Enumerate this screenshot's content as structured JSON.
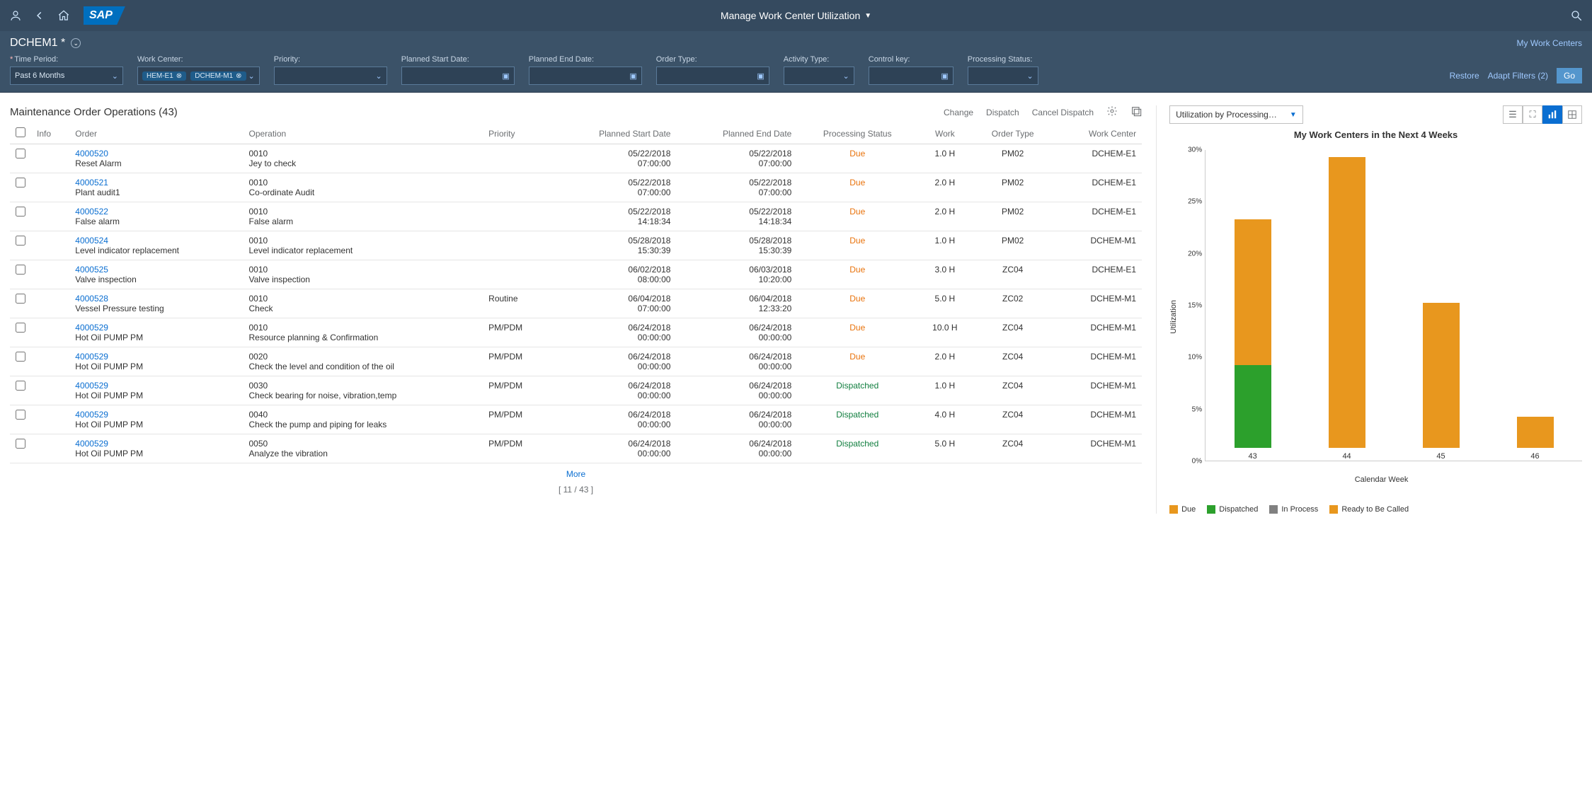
{
  "shell": {
    "title": "Manage Work Center Utilization"
  },
  "subheader": {
    "variant": "DCHEM1 *",
    "link": "My Work Centers"
  },
  "filters": {
    "time_period_label": "Time Period:",
    "time_period_value": "Past 6 Months",
    "work_center_label": "Work Center:",
    "wc_token1": "HEM-E1",
    "wc_token2": "DCHEM-M1",
    "priority_label": "Priority:",
    "planned_start_label": "Planned Start Date:",
    "planned_end_label": "Planned End Date:",
    "order_type_label": "Order Type:",
    "activity_type_label": "Activity Type:",
    "control_key_label": "Control key:",
    "processing_status_label": "Processing Status:",
    "restore": "Restore",
    "adapt": "Adapt Filters (2)",
    "go": "Go"
  },
  "table": {
    "title": "Maintenance Order Operations (43)",
    "action_change": "Change",
    "action_dispatch": "Dispatch",
    "action_cancel": "Cancel Dispatch",
    "cols": {
      "info": "Info",
      "order": "Order",
      "operation": "Operation",
      "priority": "Priority",
      "pstart": "Planned Start Date",
      "pend": "Planned End Date",
      "pstatus": "Processing Status",
      "work": "Work",
      "otype": "Order Type",
      "wc": "Work Center"
    },
    "rows": [
      {
        "order": "4000520",
        "odesc": "Reset Alarm",
        "opnum": "0010",
        "opdesc": "Jey to check",
        "priority": "",
        "pstart_d": "05/22/2018",
        "pstart_t": "07:00:00",
        "pend_d": "05/22/2018",
        "pend_t": "07:00:00",
        "status": "Due",
        "scls": "status-due",
        "work": "1.0 H",
        "otype": "PM02",
        "wc": "DCHEM-E1"
      },
      {
        "order": "4000521",
        "odesc": "Plant audit1",
        "opnum": "0010",
        "opdesc": "Co-ordinate Audit",
        "priority": "",
        "pstart_d": "05/22/2018",
        "pstart_t": "07:00:00",
        "pend_d": "05/22/2018",
        "pend_t": "07:00:00",
        "status": "Due",
        "scls": "status-due",
        "work": "2.0 H",
        "otype": "PM02",
        "wc": "DCHEM-E1"
      },
      {
        "order": "4000522",
        "odesc": "False alarm",
        "opnum": "0010",
        "opdesc": "False alarm",
        "priority": "",
        "pstart_d": "05/22/2018",
        "pstart_t": "14:18:34",
        "pend_d": "05/22/2018",
        "pend_t": "14:18:34",
        "status": "Due",
        "scls": "status-due",
        "work": "2.0 H",
        "otype": "PM02",
        "wc": "DCHEM-E1"
      },
      {
        "order": "4000524",
        "odesc": "Level indicator replacement",
        "opnum": "0010",
        "opdesc": "Level indicator replacement",
        "priority": "",
        "pstart_d": "05/28/2018",
        "pstart_t": "15:30:39",
        "pend_d": "05/28/2018",
        "pend_t": "15:30:39",
        "status": "Due",
        "scls": "status-due",
        "work": "1.0 H",
        "otype": "PM02",
        "wc": "DCHEM-M1"
      },
      {
        "order": "4000525",
        "odesc": "Valve inspection",
        "opnum": "0010",
        "opdesc": "Valve inspection",
        "priority": "",
        "pstart_d": "06/02/2018",
        "pstart_t": "08:00:00",
        "pend_d": "06/03/2018",
        "pend_t": "10:20:00",
        "status": "Due",
        "scls": "status-due",
        "work": "3.0 H",
        "otype": "ZC04",
        "wc": "DCHEM-E1"
      },
      {
        "order": "4000528",
        "odesc": "Vessel Pressure testing",
        "opnum": "0010",
        "opdesc": "Check",
        "priority": "Routine",
        "pstart_d": "06/04/2018",
        "pstart_t": "07:00:00",
        "pend_d": "06/04/2018",
        "pend_t": "12:33:20",
        "status": "Due",
        "scls": "status-due",
        "work": "5.0 H",
        "otype": "ZC02",
        "wc": "DCHEM-M1"
      },
      {
        "order": "4000529",
        "odesc": "Hot Oil PUMP PM",
        "opnum": "0010",
        "opdesc": "Resource planning & Confirmation",
        "priority": "PM/PDM",
        "pstart_d": "06/24/2018",
        "pstart_t": "00:00:00",
        "pend_d": "06/24/2018",
        "pend_t": "00:00:00",
        "status": "Due",
        "scls": "status-due",
        "work": "10.0 H",
        "otype": "ZC04",
        "wc": "DCHEM-M1"
      },
      {
        "order": "4000529",
        "odesc": "Hot Oil PUMP PM",
        "opnum": "0020",
        "opdesc": "Check the level and condition of the oil",
        "priority": "PM/PDM",
        "pstart_d": "06/24/2018",
        "pstart_t": "00:00:00",
        "pend_d": "06/24/2018",
        "pend_t": "00:00:00",
        "status": "Due",
        "scls": "status-due",
        "work": "2.0 H",
        "otype": "ZC04",
        "wc": "DCHEM-M1"
      },
      {
        "order": "4000529",
        "odesc": "Hot Oil PUMP PM",
        "opnum": "0030",
        "opdesc": "Check bearing for noise, vibration,temp",
        "priority": "PM/PDM",
        "pstart_d": "06/24/2018",
        "pstart_t": "00:00:00",
        "pend_d": "06/24/2018",
        "pend_t": "00:00:00",
        "status": "Dispatched",
        "scls": "status-dispatched",
        "work": "1.0 H",
        "otype": "ZC04",
        "wc": "DCHEM-M1"
      },
      {
        "order": "4000529",
        "odesc": "Hot Oil PUMP PM",
        "opnum": "0040",
        "opdesc": "Check the pump and piping for leaks",
        "priority": "PM/PDM",
        "pstart_d": "06/24/2018",
        "pstart_t": "00:00:00",
        "pend_d": "06/24/2018",
        "pend_t": "00:00:00",
        "status": "Dispatched",
        "scls": "status-dispatched",
        "work": "4.0 H",
        "otype": "ZC04",
        "wc": "DCHEM-M1"
      },
      {
        "order": "4000529",
        "odesc": "Hot Oil PUMP PM",
        "opnum": "0050",
        "opdesc": "Analyze the vibration",
        "priority": "PM/PDM",
        "pstart_d": "06/24/2018",
        "pstart_t": "00:00:00",
        "pend_d": "06/24/2018",
        "pend_t": "00:00:00",
        "status": "Dispatched",
        "scls": "status-dispatched",
        "work": "5.0 H",
        "otype": "ZC04",
        "wc": "DCHEM-M1"
      }
    ],
    "more": "More",
    "count": "[ 11 / 43 ]"
  },
  "chart": {
    "selector": "Utilization by Processing…",
    "title": "My Work Centers in the Next 4 Weeks",
    "yaxis": "Utilization",
    "xaxis": "Calendar Week",
    "legend": {
      "due": "Due",
      "dispatched": "Dispatched",
      "inprocess": "In Process",
      "ready": "Ready to Be Called"
    },
    "colors": {
      "due": "#e8971e",
      "dispatched": "#2ca02c",
      "inprocess": "#808080",
      "ready": "#e8971e"
    },
    "yticks": [
      "0%",
      "5%",
      "10%",
      "15%",
      "20%",
      "25%",
      "30%"
    ]
  },
  "chart_data": {
    "type": "bar",
    "categories": [
      "43",
      "44",
      "45",
      "46"
    ],
    "series": [
      {
        "name": "Dispatched",
        "values": [
          8,
          0,
          0,
          0
        ]
      },
      {
        "name": "Due",
        "values": [
          14,
          28,
          14,
          3
        ]
      }
    ],
    "ylabel": "Utilization",
    "xlabel": "Calendar Week",
    "ylim": [
      0,
      30
    ],
    "title": "My Work Centers in the Next 4 Weeks"
  }
}
